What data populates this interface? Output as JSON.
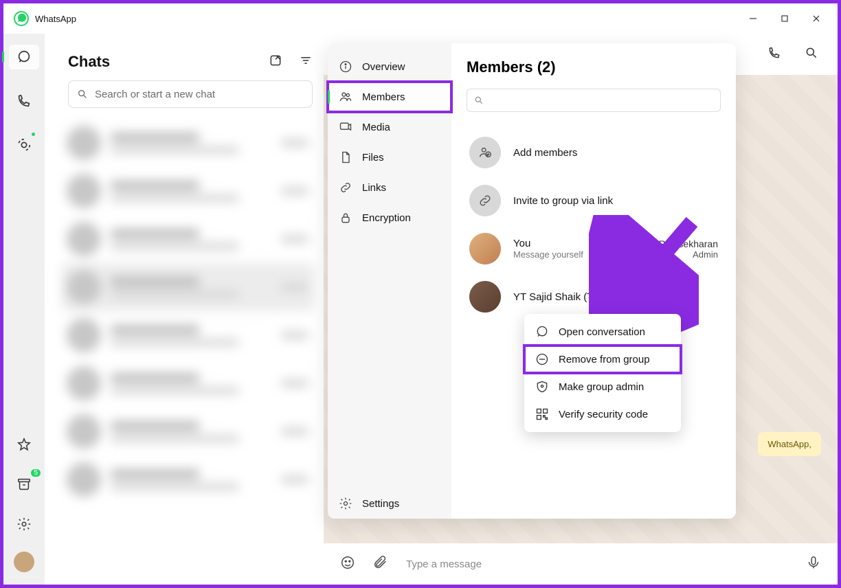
{
  "app": {
    "name": "WhatsApp"
  },
  "rail": {
    "archived_badge": "5"
  },
  "chats": {
    "title": "Chats",
    "search_placeholder": "Search or start a new chat"
  },
  "main": {
    "message_placeholder": "Type a message",
    "note_text": "WhatsApp,"
  },
  "panel": {
    "nav": {
      "overview": "Overview",
      "members": "Members",
      "media": "Media",
      "files": "Files",
      "links": "Links",
      "encryption": "Encryption",
      "settings": "Settings"
    },
    "title": "Members (2)",
    "actions": {
      "add_members": "Add members",
      "invite_link": "Invite to group via link"
    },
    "members": [
      {
        "name": "You",
        "sub": "Message yourself",
        "nick": "n Rajasekharan",
        "role": "Admin"
      },
      {
        "name": "YT Sajid Shaik (TechBaked)"
      }
    ]
  },
  "context": {
    "open": "Open conversation",
    "remove": "Remove from group",
    "admin": "Make group admin",
    "verify": "Verify security code"
  }
}
